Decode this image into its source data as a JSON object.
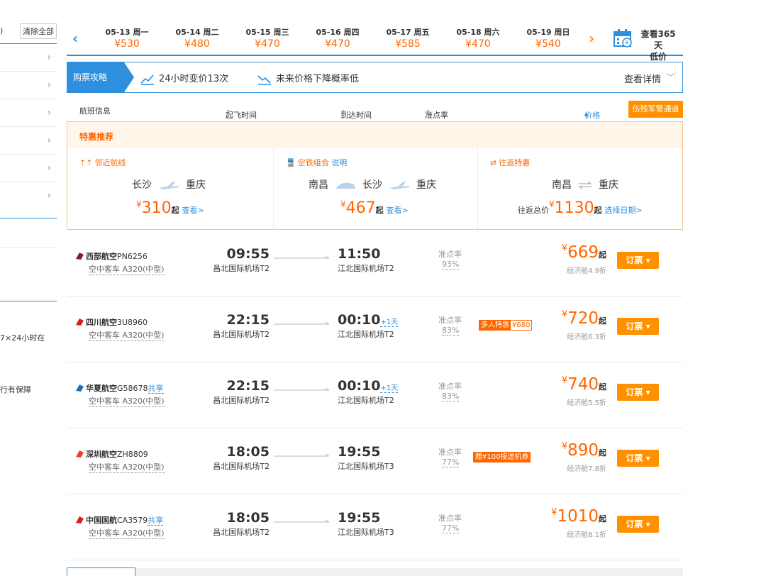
{
  "sidebar": {
    "top_char": ")",
    "clear_all": "清除全部",
    "text1": "7×24小时在",
    "text2": "行有保障"
  },
  "datebar": {
    "dates": [
      {
        "date": "05-13 周一",
        "price": "¥530"
      },
      {
        "date": "05-14 周二",
        "price": "¥480"
      },
      {
        "date": "05-15 周三",
        "price": "¥470"
      },
      {
        "date": "05-16 周四",
        "price": "¥470"
      },
      {
        "date": "05-17 周五",
        "price": "¥585"
      },
      {
        "date": "05-18 周六",
        "price": "¥470"
      },
      {
        "date": "05-19 周日",
        "price": "¥540"
      }
    ],
    "view365_line1": "查看365天",
    "view365_line2": "低价"
  },
  "strategy": {
    "tag": "购票攻略",
    "item1": "24小时变价13次",
    "item2": "未来价格下降概率低",
    "detail": "查看详情"
  },
  "table_header": {
    "flight_info": "航班信息",
    "dep_time": "起飞时间",
    "arr_time": "到达时间",
    "ontime": "准点率",
    "price": "价格",
    "military": "伤残军警通道"
  },
  "specials": {
    "title": "特惠推荐",
    "nearby": {
      "label": "邻近航线",
      "from": "长沙",
      "to": "重庆",
      "yen": "¥",
      "price": "310",
      "qi": "起",
      "view": "查看>"
    },
    "rail": {
      "label": "空铁组合",
      "explain": "说明",
      "from": "南昌",
      "via": "长沙",
      "to": "重庆",
      "yen": "¥",
      "price": "467",
      "qi": "起",
      "view": "查看>"
    },
    "roundtrip": {
      "label": "往返特惠",
      "from": "南昌",
      "to": "重庆",
      "total_label": "往返总价",
      "yen": "¥",
      "price": "1130",
      "qi": "起",
      "choose": "选择日期>"
    }
  },
  "flights": [
    {
      "airline": "西部航空",
      "code": "PN6256",
      "share": "",
      "plane": "空中客车 A320(中型)",
      "dep_time": "09:55",
      "dep_airport": "昌北国际机场T2",
      "arr_time": "11:50",
      "plus_day": "",
      "arr_airport": "江北国际机场T2",
      "ontime_label": "准点率",
      "ontime": "93%",
      "promo_a": "",
      "promo_b": "",
      "yen": "¥",
      "price": "669",
      "qi": "起",
      "cabin": "经济舱4.9折",
      "book": "订票 ▾",
      "logo_color": "#8b1a2b"
    },
    {
      "airline": "四川航空",
      "code": "3U8960",
      "share": "",
      "plane": "空中客车 A320(中型)",
      "dep_time": "22:15",
      "dep_airport": "昌北国际机场T2",
      "arr_time": "00:10",
      "plus_day": "+1天",
      "arr_airport": "江北国际机场T2",
      "ontime_label": "准点率",
      "ontime": "83%",
      "promo_a": "多人特惠",
      "promo_b": "¥680",
      "yen": "¥",
      "price": "720",
      "qi": "起",
      "cabin": "经济舱6.3折",
      "book": "订票 ▾",
      "logo_color": "#d4201e"
    },
    {
      "airline": "华夏航空",
      "code": "G58678",
      "share": "共享",
      "plane": "空中客车 A320(中型)",
      "dep_time": "22:15",
      "dep_airport": "昌北国际机场T2",
      "arr_time": "00:10",
      "plus_day": "+1天",
      "arr_airport": "江北国际机场T2",
      "ontime_label": "准点率",
      "ontime": "83%",
      "promo_a": "",
      "promo_b": "",
      "yen": "¥",
      "price": "740",
      "qi": "起",
      "cabin": "经济舱5.5折",
      "book": "订票 ▾",
      "logo_color": "#1a6fc1"
    },
    {
      "airline": "深圳航空",
      "code": "ZH8809",
      "share": "",
      "plane": "空中客车 A320(中型)",
      "dep_time": "18:05",
      "dep_airport": "昌北国际机场T2",
      "arr_time": "19:55",
      "plus_day": "",
      "arr_airport": "江北国际机场T3",
      "ontime_label": "准点率",
      "ontime": "77%",
      "promo_a": "赠¥100接送机券",
      "promo_b": "",
      "yen": "¥",
      "price": "890",
      "qi": "起",
      "cabin": "经济舱7.8折",
      "book": "订票 ▾",
      "logo_color": "#e8431d"
    },
    {
      "airline": "中国国航",
      "code": "CA3579",
      "share": "共享",
      "plane": "空中客车 A320(中型)",
      "dep_time": "18:05",
      "dep_airport": "昌北国际机场T2",
      "arr_time": "19:55",
      "plus_day": "",
      "arr_airport": "江北国际机场T3",
      "ontime_label": "准点率",
      "ontime": "77%",
      "promo_a": "",
      "promo_b": "",
      "yen": "¥",
      "price": "1010",
      "qi": "起",
      "cabin": "经济舱8.1折",
      "book": "订票 ▾",
      "logo_color": "#d4201e"
    }
  ],
  "colors": {
    "accent_blue": "#2d8fdd",
    "accent_orange": "#ff6600",
    "button_orange": "#ff9000"
  }
}
